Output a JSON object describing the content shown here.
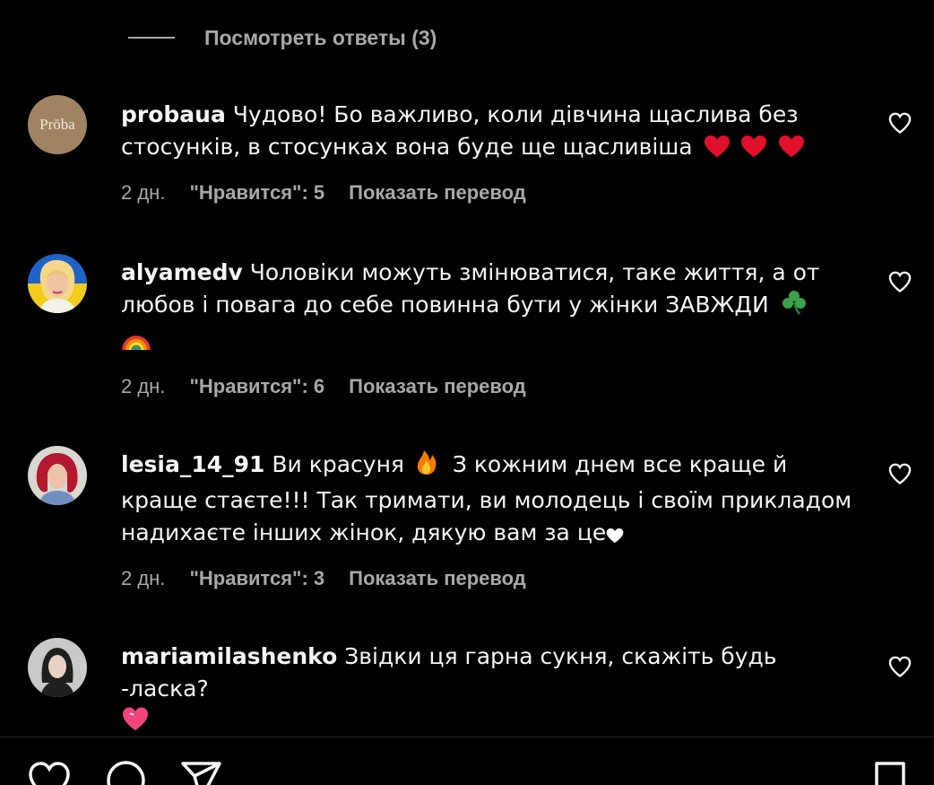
{
  "replies": {
    "label": "Посмотреть ответы (3)"
  },
  "comments": [
    {
      "username": "probaua",
      "text": "Чудово! Бо важливо, коли дівчина щаслива без стосунків, в стосунках вона буде ще щасливіша",
      "age": "2 дн.",
      "likes": "\"Нравится\": 5",
      "translate": "Показать перевод",
      "avatar_label": "Prōba"
    },
    {
      "username": "alyamedv",
      "text": "Чоловіки можуть змінюватися, таке життя, а от любов і повага до себе повинна бути у жінки ЗАВЖДИ",
      "age": "2 дн.",
      "likes": "\"Нравится\": 6",
      "translate": "Показать перевод"
    },
    {
      "username": "lesia_14_91",
      "text_a": "Ви красуня",
      "text_b": "З кожним днем все краще й краще стаєте!!! Так тримати, ви молодець і своїм прикладом надихаєте інших жінок, дякую вам за це",
      "age": "2 дн.",
      "likes": "\"Нравится\": 3",
      "translate": "Показать перевод"
    },
    {
      "username": "mariamilashenko",
      "text": "Звідки ця гарна сукня, скажіть будь -ласка?"
    }
  ],
  "icons": {
    "like": "heart-outline-icon",
    "comment": "speech-bubble-icon",
    "share": "paper-plane-icon",
    "save": "bookmark-icon"
  },
  "colors": {
    "background": "#000000",
    "text": "#f5f5f5",
    "secondary": "#a8a8a8",
    "heart_emoji": "#e0102a"
  }
}
